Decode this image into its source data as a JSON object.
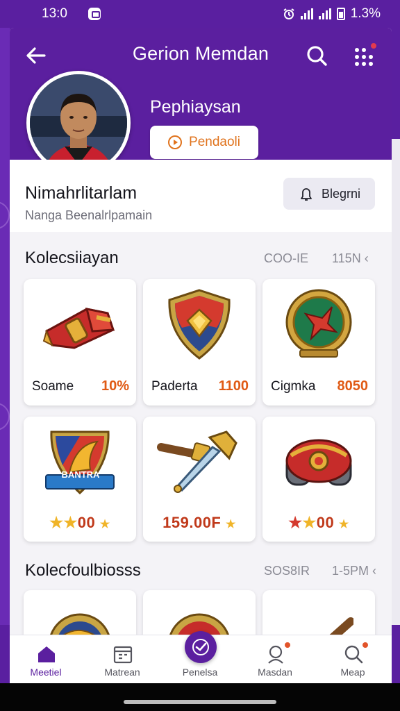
{
  "status_bar": {
    "time": "13:0",
    "battery": "1.3%"
  },
  "header": {
    "title": "Gerion Memdan",
    "profile_name": "Pephiaysan",
    "follow_label": "Pendaoli"
  },
  "info": {
    "name": "Nimahrlitarlam",
    "subtitle": "Nanga Beenalrlpamain",
    "message_label": "Blegrni"
  },
  "sections": [
    {
      "title": "Kolecsiiayan",
      "meta1": "COO-IE",
      "meta2": "115N ‹"
    },
    {
      "title": "Kolecfoulbiosss",
      "meta1": "SOS8IR",
      "meta2": "1-5PM ‹"
    }
  ],
  "cards": [
    {
      "label": "Soame",
      "value": "10%",
      "art": "gauntlet-icon"
    },
    {
      "label": "Paderta",
      "value": "1100",
      "art": "shield-icon"
    },
    {
      "label": "Cigmka",
      "value": "8050",
      "art": "medal-icon"
    },
    {
      "rating": "00",
      "stars": 3,
      "art": "flag-shield-icon",
      "banner": "BANTRA"
    },
    {
      "rating": "159.00F",
      "art": "sword-icon"
    },
    {
      "rating": "00",
      "stars": 3,
      "art": "bracer-icon"
    }
  ],
  "tabs": [
    {
      "label": "Meetiel",
      "icon": "home-icon"
    },
    {
      "label": "Matrean",
      "icon": "calendar-icon"
    },
    {
      "label": "Penelsa",
      "icon": "check-icon"
    },
    {
      "label": "Masdan",
      "icon": "person-icon"
    },
    {
      "label": "Meap",
      "icon": "search-icon"
    }
  ],
  "colors": {
    "primary": "#5b1f9f",
    "accent": "#e0731d",
    "value": "#e05a14"
  }
}
